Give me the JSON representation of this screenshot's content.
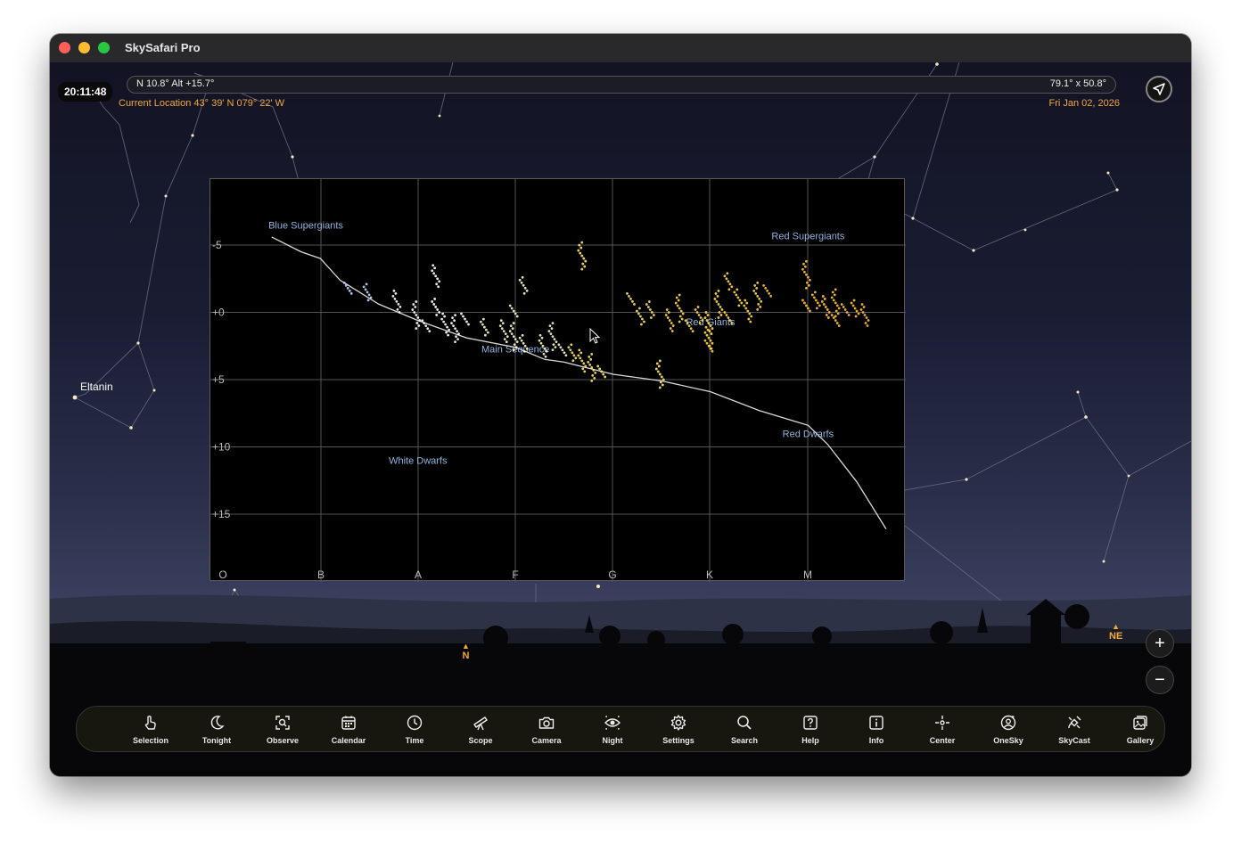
{
  "window": {
    "title": "SkySafari Pro"
  },
  "hud": {
    "time": "20:11:48",
    "position": "N 10.8° Alt +15.7°",
    "field_of_view": "79.1° x 50.8°",
    "location": "Current Location  43° 39' N 079° 22' W",
    "date": "Fri Jan 02, 2026"
  },
  "sky_labels": {
    "star": "Eltanin",
    "dir_n": "N",
    "dir_ne": "NE"
  },
  "zoom": {
    "in": "+",
    "out": "−"
  },
  "toolbar": [
    {
      "label": "Selection",
      "icon": "hand-pointer-icon"
    },
    {
      "label": "Tonight",
      "icon": "moon-icon"
    },
    {
      "label": "Observe",
      "icon": "observe-icon"
    },
    {
      "label": "Calendar",
      "icon": "calendar-icon"
    },
    {
      "label": "Time",
      "icon": "clock-icon"
    },
    {
      "label": "Scope",
      "icon": "telescope-icon"
    },
    {
      "label": "Camera",
      "icon": "camera-icon"
    },
    {
      "label": "Night",
      "icon": "eye-icon"
    },
    {
      "label": "Settings",
      "icon": "gear-icon"
    },
    {
      "label": "Search",
      "icon": "search-icon"
    },
    {
      "label": "Help",
      "icon": "help-icon"
    },
    {
      "label": "Info",
      "icon": "info-icon"
    },
    {
      "label": "Center",
      "icon": "crosshair-icon"
    },
    {
      "label": "OneSky",
      "icon": "onesky-icon"
    },
    {
      "label": "SkyCast",
      "icon": "satellite-icon"
    },
    {
      "label": "Gallery",
      "icon": "gallery-icon"
    }
  ],
  "chart_data": {
    "type": "scatter",
    "x_ticks": [
      "O",
      "B",
      "A",
      "F",
      "G",
      "K",
      "M"
    ],
    "y_ticks": [
      "-5",
      "+0",
      "+5",
      "+10",
      "+15"
    ],
    "ylim": [
      -7.5,
      20
    ],
    "grid": true,
    "region_labels": [
      "Blue Supergiants",
      "Red Supergiants",
      "Red Giants",
      "Main Sequence",
      "Red Dwarfs",
      "White Dwarfs"
    ],
    "series": [
      {
        "type": "line",
        "points": [
          [
            0.5,
            -5.6
          ],
          [
            0.8,
            -4.5
          ],
          [
            1.0,
            -4.0
          ],
          [
            1.2,
            -2.4
          ],
          [
            1.6,
            -0.6
          ],
          [
            2.0,
            0.6
          ],
          [
            2.5,
            1.9
          ],
          [
            3.0,
            2.6
          ],
          [
            3.3,
            3.5
          ],
          [
            3.5,
            3.7
          ],
          [
            4.0,
            4.6
          ],
          [
            4.5,
            5.1
          ],
          [
            5.0,
            5.9
          ],
          [
            5.5,
            7.3
          ],
          [
            6.0,
            8.4
          ],
          [
            6.2,
            9.8
          ],
          [
            6.5,
            12.6
          ],
          [
            6.8,
            16.1
          ]
        ]
      },
      {
        "type": "stars",
        "points": [
          [
            1.3,
            -1.8
          ],
          [
            1.5,
            -1.5
          ],
          [
            1.8,
            -0.8
          ],
          [
            2.0,
            0.2
          ],
          [
            2.1,
            1.0
          ],
          [
            2.2,
            -0.4
          ],
          [
            2.3,
            0.9
          ],
          [
            2.4,
            1.2
          ],
          [
            2.5,
            0.5
          ],
          [
            2.7,
            1.1
          ],
          [
            2.9,
            1.4
          ],
          [
            3.0,
            1.8
          ],
          [
            3.0,
            -0.1
          ],
          [
            3.1,
            2.3
          ],
          [
            3.3,
            2.5
          ],
          [
            3.4,
            1.8
          ],
          [
            3.5,
            2.8
          ],
          [
            3.6,
            3.0
          ],
          [
            3.7,
            3.6
          ],
          [
            3.8,
            4.1
          ],
          [
            3.9,
            4.4
          ],
          [
            3.1,
            -2.0
          ],
          [
            2.2,
            -2.7
          ],
          [
            3.7,
            -4.2
          ]
        ]
      },
      {
        "type": "giants",
        "points": [
          [
            4.2,
            -1.0
          ],
          [
            4.4,
            -0.2
          ],
          [
            4.6,
            0.6
          ],
          [
            4.7,
            -0.3
          ],
          [
            4.8,
            1.0
          ],
          [
            4.9,
            0.2
          ],
          [
            5.0,
            0.8
          ],
          [
            5.1,
            -0.6
          ],
          [
            5.2,
            0.4
          ],
          [
            5.3,
            -1.1
          ],
          [
            5.4,
            -0.1
          ],
          [
            5.5,
            -1.2
          ],
          [
            5.6,
            -1.6
          ],
          [
            4.3,
            0.3
          ],
          [
            5.0,
            1.9
          ],
          [
            4.5,
            4.6
          ],
          [
            5.0,
            2.5
          ],
          [
            5.2,
            -2.3
          ]
        ]
      },
      {
        "type": "supergiants",
        "points": [
          [
            6.0,
            -0.5
          ],
          [
            6.1,
            -0.9
          ],
          [
            6.2,
            -0.4
          ],
          [
            6.3,
            -0.7
          ],
          [
            6.4,
            -0.2
          ],
          [
            6.5,
            -0.3
          ],
          [
            6.6,
            0.2
          ],
          [
            6.0,
            -2.8
          ],
          [
            6.3,
            0.6
          ]
        ]
      }
    ]
  }
}
